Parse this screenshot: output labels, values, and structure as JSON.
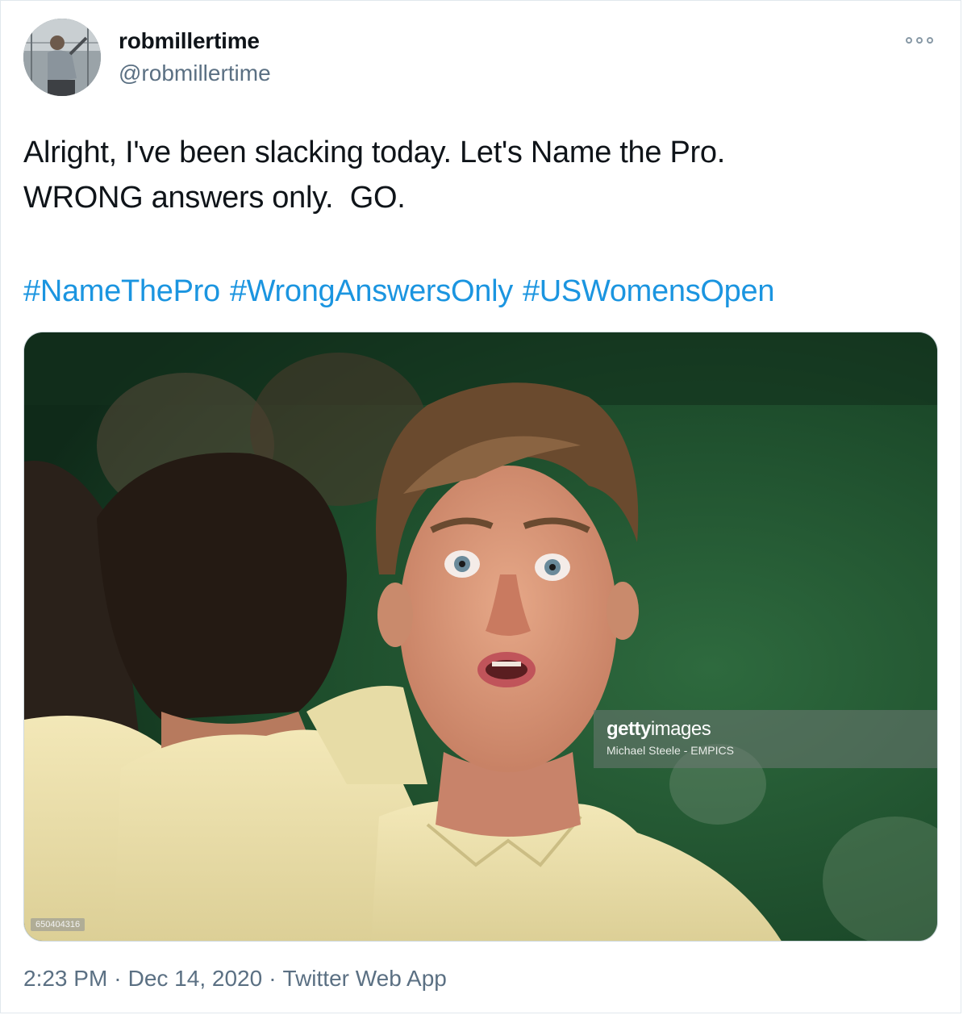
{
  "author": {
    "display_name": "robmillertime",
    "handle": "@robmillertime",
    "avatar_icon": "avatar-photo"
  },
  "tweet": {
    "line1": "Alright, I've been slacking today. Let's Name the Pro.",
    "line2": "WRONG answers only.  GO.",
    "hashtags": [
      "#NameThePro",
      "#WrongAnswersOnly",
      "#USWomensOpen"
    ]
  },
  "media": {
    "watermark_brand_bold": "getty",
    "watermark_brand_light": "images",
    "watermark_credit": "Michael Steele - EMPICS",
    "image_id": "650404316"
  },
  "meta": {
    "time": "2:23 PM",
    "date": "Dec 14, 2020",
    "source": "Twitter Web App",
    "separator": "·"
  },
  "colors": {
    "hashtag": "#1b95e0",
    "secondary_text": "#5b7083",
    "primary_text": "#0f1419"
  }
}
